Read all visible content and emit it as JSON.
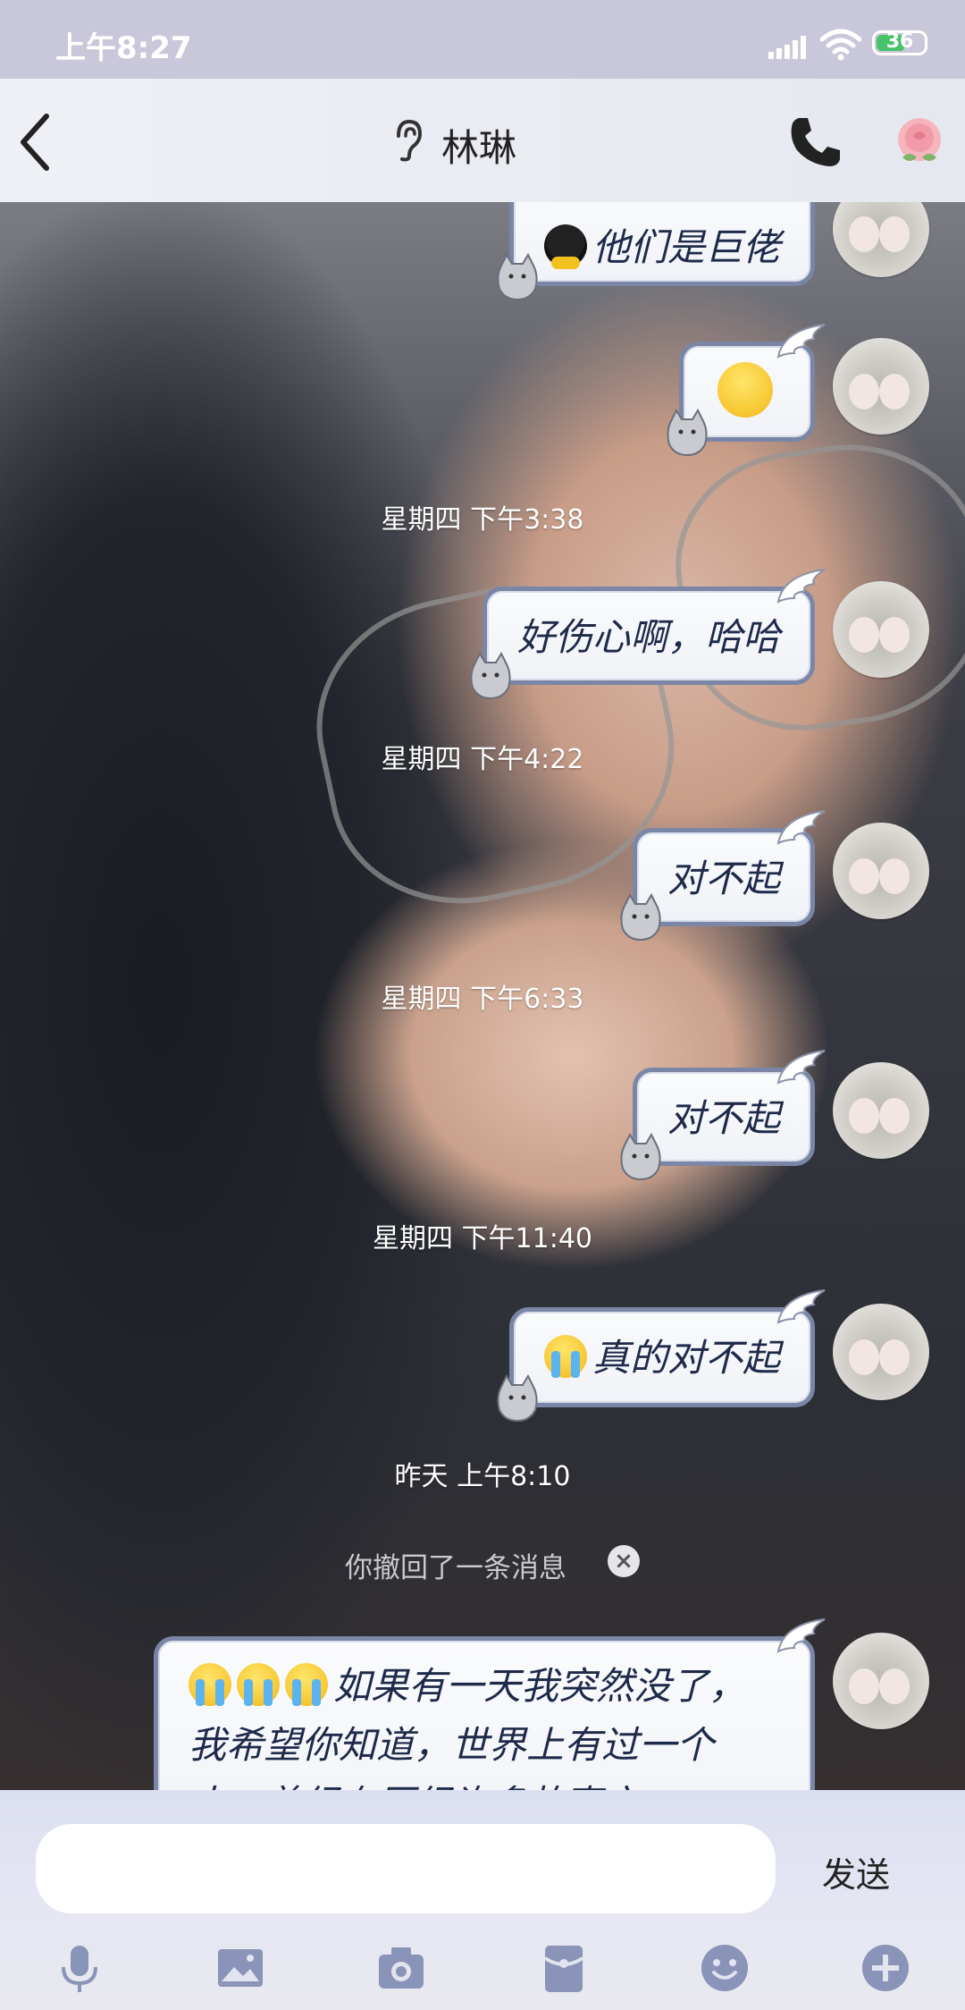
{
  "status_bar": {
    "time": "上午8:27",
    "battery": "36"
  },
  "header": {
    "contact_name": "林琳"
  },
  "messages": [
    {
      "text": "他们是巨佬"
    },
    {
      "text": ""
    },
    {
      "text": "好伤心啊，哈哈"
    },
    {
      "text": "对不起"
    },
    {
      "text": "对不起"
    },
    {
      "text": "真的对不起"
    },
    {
      "text": "如果有一天我突然没了，我希望你知道，世界上有过一个人，曾经在历经许多故事之"
    }
  ],
  "timestamps": [
    "星期四 下午3:38",
    "星期四 下午4:22",
    "星期四 下午6:33",
    "星期四 下午11:40",
    "昨天 上午8:10"
  ],
  "recall_notice": "你撤回了一条消息",
  "composer": {
    "placeholder": "",
    "send_label": "发送"
  },
  "toolbar_icons": [
    "microphone-icon",
    "image-icon",
    "camera-icon",
    "red-packet-icon",
    "emoji-icon",
    "plus-icon"
  ],
  "colors": {
    "bubble_border": "#7b86a6",
    "bubble_text": "#1e2a4a",
    "status_bar": "#c9c7da"
  }
}
